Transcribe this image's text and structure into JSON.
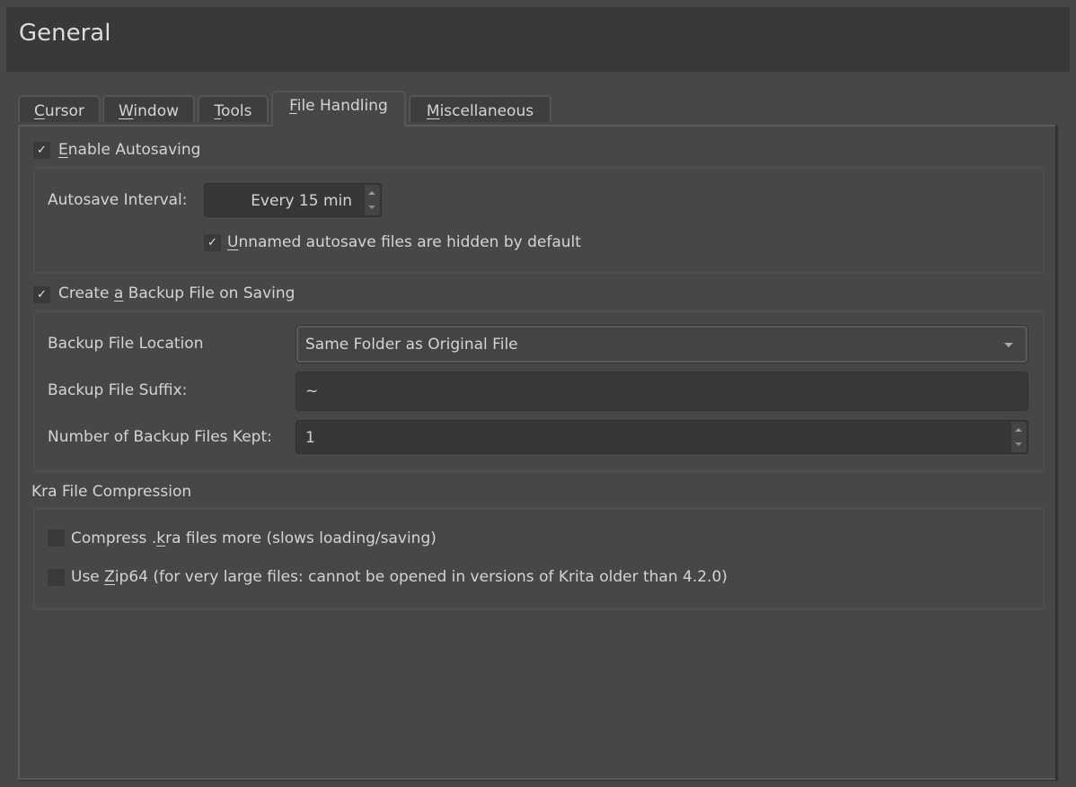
{
  "header": {
    "title": "General"
  },
  "tabs": [
    {
      "label": "Cursor",
      "mnemonic": "C",
      "rest": "ursor",
      "active": false
    },
    {
      "label": "Window",
      "mnemonic": "W",
      "rest": "indow",
      "active": false
    },
    {
      "label": "Tools",
      "mnemonic": "T",
      "rest": "ools",
      "active": false
    },
    {
      "label": "File Handling",
      "mnemonic": "F",
      "rest": "ile Handling",
      "active": true
    },
    {
      "label": "Miscellaneous",
      "mnemonic": "M",
      "rest": "iscellaneous",
      "active": false
    }
  ],
  "autosave": {
    "enable": {
      "checked": true,
      "pre": "",
      "mnemonic": "E",
      "rest": "nable Autosaving"
    },
    "interval_label": "Autosave Interval:",
    "interval_value": "Every 15 min",
    "unnamed_hidden": {
      "checked": true,
      "pre": "",
      "mnemonic": "U",
      "rest": "nnamed autosave files are hidden by default"
    },
    "check_glyph": "✓"
  },
  "backup": {
    "enable": {
      "checked": true,
      "pre": "Create ",
      "mnemonic": "a",
      "rest": " Backup File on Saving"
    },
    "location_label": "Backup File Location",
    "location_value": "Same Folder as Original File",
    "suffix_label": "Backup File Suffix:",
    "suffix_value": "~",
    "count_label": "Number of Backup Files Kept:",
    "count_value": "1"
  },
  "compression": {
    "title": "Kra File Compression",
    "compress_more": {
      "checked": false,
      "pre": "Compress .",
      "mnemonic": "k",
      "rest": "ra files more (slows loading/saving)"
    },
    "zip64": {
      "checked": false,
      "pre": "Use ",
      "mnemonic": "Z",
      "rest": "ip64 (for very large files: cannot be opened in versions of Krita older than 4.2.0)"
    }
  }
}
